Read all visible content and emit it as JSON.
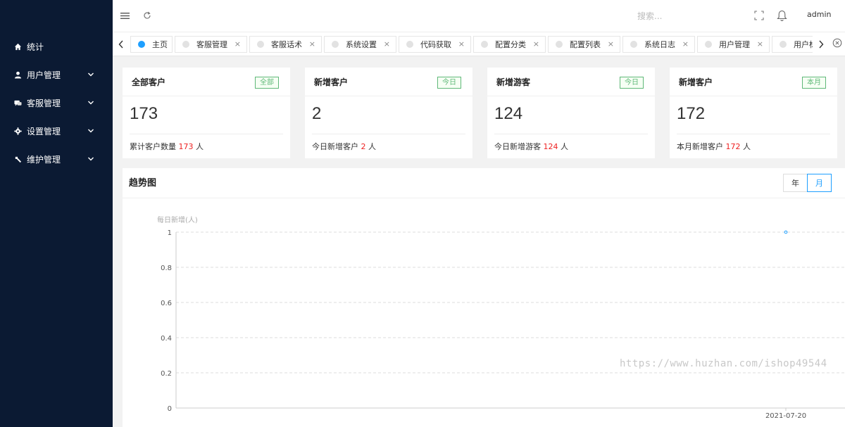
{
  "sidebar": {
    "items": [
      {
        "label": "统计",
        "icon": "home-icon",
        "has_children": false
      },
      {
        "label": "用户管理",
        "icon": "user-icon",
        "has_children": true
      },
      {
        "label": "客服管理",
        "icon": "chat-icon",
        "has_children": true
      },
      {
        "label": "设置管理",
        "icon": "gear-icon",
        "has_children": true
      },
      {
        "label": "维护管理",
        "icon": "wrench-icon",
        "has_children": true
      }
    ]
  },
  "header": {
    "search_placeholder": "搜索...",
    "user_name": "admin"
  },
  "tabs": [
    {
      "label": "主页",
      "active": true,
      "closable": false
    },
    {
      "label": "客服管理",
      "active": false,
      "closable": true
    },
    {
      "label": "客服话术",
      "active": false,
      "closable": true
    },
    {
      "label": "系统设置",
      "active": false,
      "closable": true
    },
    {
      "label": "代码获取",
      "active": false,
      "closable": true
    },
    {
      "label": "配置分类",
      "active": false,
      "closable": true
    },
    {
      "label": "配置列表",
      "active": false,
      "closable": true
    },
    {
      "label": "系统日志",
      "active": false,
      "closable": true
    },
    {
      "label": "用户管理",
      "active": false,
      "closable": true
    },
    {
      "label": "用户标",
      "active": false,
      "closable": false
    }
  ],
  "tab_close_glyph": "×",
  "cards": [
    {
      "title": "全部客户",
      "badge": "全部",
      "value": "173",
      "desc_prefix": "累计客户数量 ",
      "desc_value": "173",
      "desc_suffix": " 人"
    },
    {
      "title": "新增客户",
      "badge": "今日",
      "value": "2",
      "desc_prefix": "今日新增客户 ",
      "desc_value": "2",
      "desc_suffix": " 人"
    },
    {
      "title": "新增游客",
      "badge": "今日",
      "value": "124",
      "desc_prefix": "今日新增游客 ",
      "desc_value": "124",
      "desc_suffix": " 人"
    },
    {
      "title": "新增客户",
      "badge": "本月",
      "value": "172",
      "desc_prefix": "本月新增客户 ",
      "desc_value": "172",
      "desc_suffix": " 人"
    }
  ],
  "trend": {
    "title": "趋势图",
    "segments": [
      {
        "label": "年",
        "active": false
      },
      {
        "label": "月",
        "active": true
      }
    ]
  },
  "watermark": "https://www.huzhan.com/ishop49544",
  "colors": {
    "sidebar_bg": "#0b1a33",
    "accent": "#1e9fff",
    "badge_green": "#5fb878",
    "highlight_red": "#e22222"
  },
  "chart_data": {
    "type": "line",
    "ylabel": "每日新增(人)",
    "ylim": [
      0,
      1
    ],
    "yticks": [
      "0",
      "0.2",
      "0.4",
      "0.6",
      "0.8",
      "1"
    ],
    "x": [
      "2021-07-20"
    ],
    "series": [
      {
        "values": [
          1
        ]
      }
    ],
    "grid": true
  }
}
